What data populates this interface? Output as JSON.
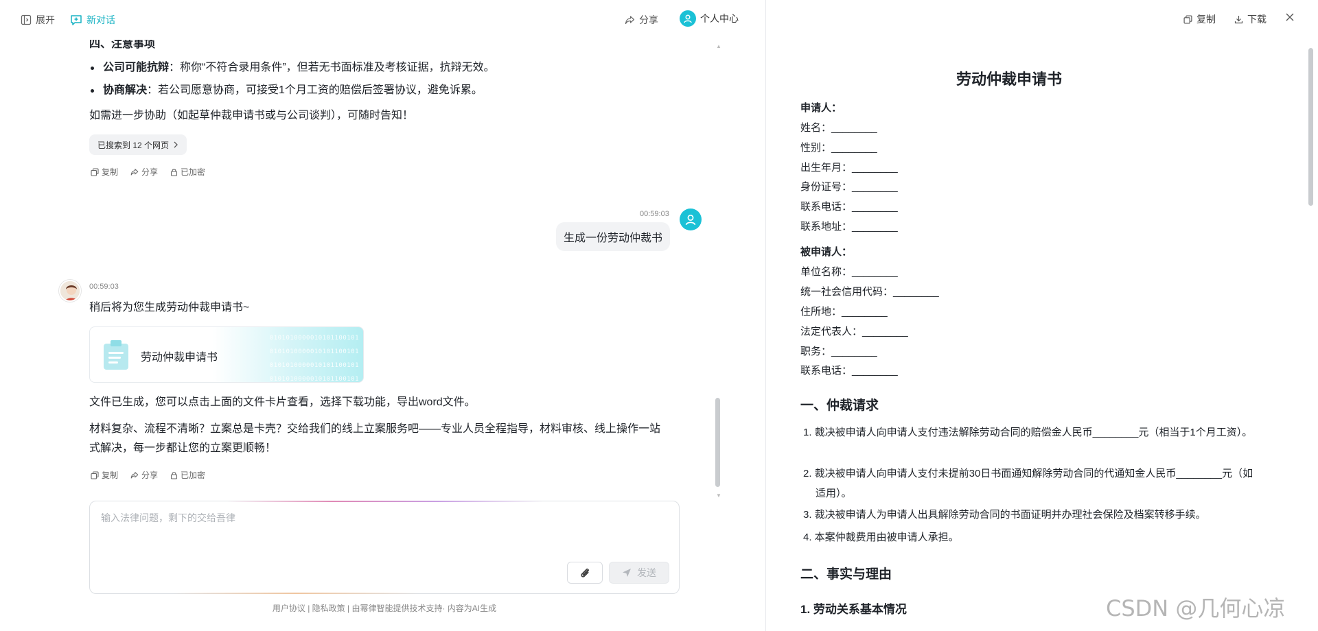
{
  "topbar": {
    "expand_label": "展开",
    "new_chat_label": "新对话",
    "share_label": "分享",
    "profile_label": "个人中心"
  },
  "conversation": {
    "partial_heading": "四、注意事项",
    "bullets": [
      {
        "bold": "公司可能抗辩",
        "text": "：称你“不符合录用条件”，但若无书面标准及考核证据，抗辩无效。"
      },
      {
        "bold": "协商解决",
        "text": "：若公司愿意协商，可接受1个月工资的赔偿后签署协议，避免诉累。"
      }
    ],
    "followup": "如需进一步协助（如起草仲裁申请书或与公司谈判），可随时告知！",
    "search_chip": "已搜索到 12 个网页",
    "actions": {
      "copy": "复制",
      "share": "分享",
      "encrypted": "已加密"
    },
    "user_message": {
      "time": "00:59:03",
      "text": "生成一份劳动仲裁书"
    },
    "bot_message": {
      "time": "00:59:03",
      "intro": "稍后将为您生成劳动仲裁申请书~",
      "file_name": "劳动仲裁申请书",
      "file_binary": [
        "0101010000010101100101",
        "0101010000010101100101",
        "0101010000010101100101",
        "0101010000010101100101"
      ],
      "generated_note": "文件已生成，您可以点击上面的文件卡片查看，选择下载功能，导出word文件。",
      "promo_line1": "材料复杂、流程不清晰？立案总是卡壳？交给我们的线上立案服务吧——专业人员全程指导，材料审核、线上操作一站",
      "promo_line2": "式解决，每一步都让您的立案更顺畅！"
    }
  },
  "input": {
    "placeholder": "输入法律问题，剩下的交给吾律",
    "send_label": "发送"
  },
  "footer": "用户协议 | 隐私政策 | 由幂律智能提供技术支持· 内容为AI生成",
  "doc_toolbar": {
    "copy_label": "复制",
    "download_label": "下载"
  },
  "document": {
    "title": "劳动仲裁申请书",
    "applicant_heading": "申请人：",
    "applicant_fields": [
      "姓名：________",
      "性别：________",
      "出生年月：________",
      "身份证号：________",
      "联系电话：________",
      "联系地址：________"
    ],
    "respondent_heading": "被申请人：",
    "respondent_fields": [
      "单位名称：________",
      "统一社会信用代码：________",
      "住所地：________",
      "法定代表人：________",
      "职务：________",
      "联系电话：________"
    ],
    "section1_heading": "一、仲裁请求",
    "requests": [
      "1. 裁决被申请人向申请人支付违法解除劳动合同的赔偿金人民币________元（相当于1个月工资）。",
      "2. 裁决被申请人向申请人支付未提前30日书面通知解除劳动合同的代通知金人民币________元（如适用）。",
      "3. 裁决被申请人为申请人出具解除劳动合同的书面证明并办理社会保险及档案转移手续。",
      "4. 本案仲裁费用由被申请人承担。"
    ],
    "section2_heading": "二、事实与理由",
    "subsection1_heading": "1. 劳动关系基本情况"
  },
  "watermark": "CSDN @几何心凉"
}
